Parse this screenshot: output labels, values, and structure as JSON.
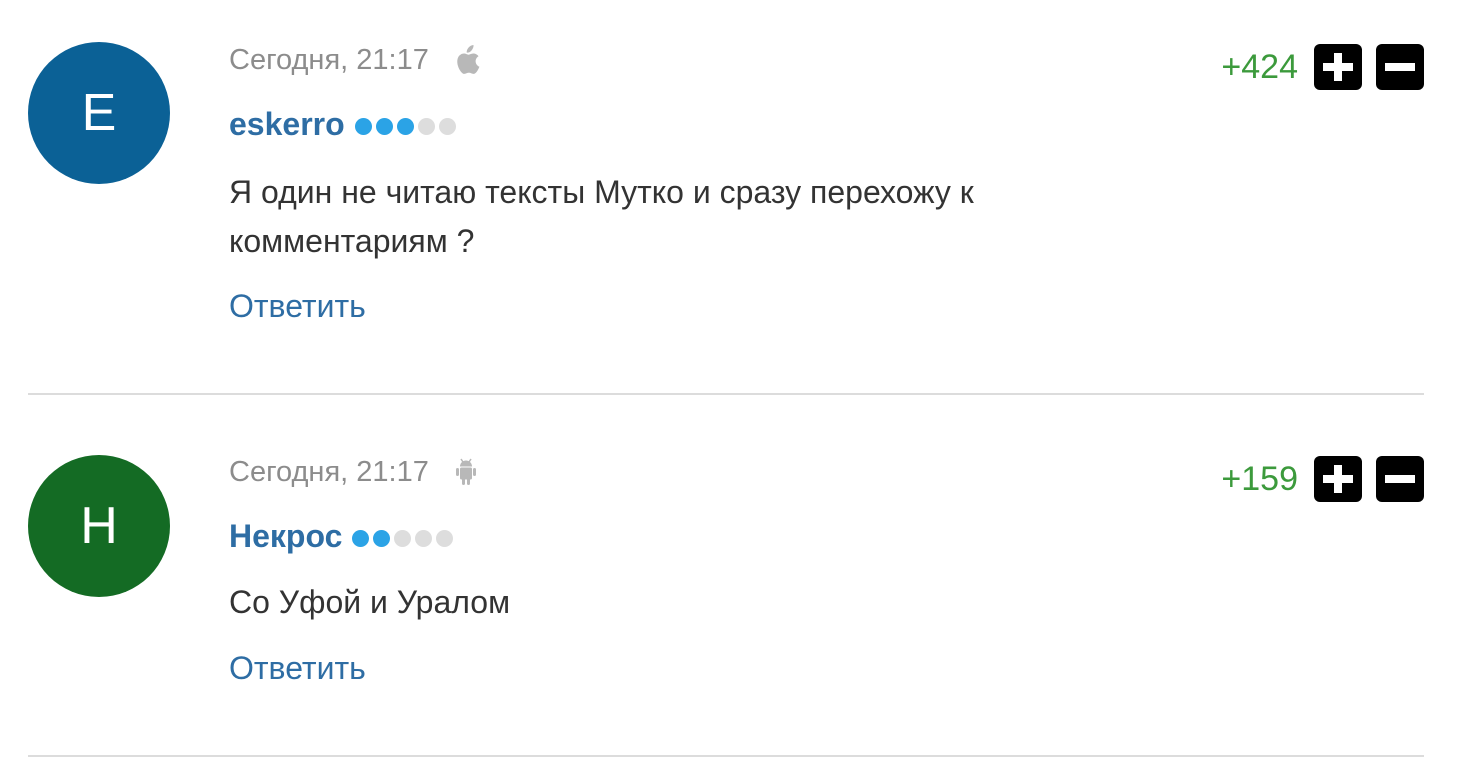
{
  "comments": [
    {
      "avatar_letter": "E",
      "avatar_color": "#0b6196",
      "time": "Сегодня, 21:17",
      "device": "apple-icon",
      "author": "eskerro",
      "rank_filled": 3,
      "rank_total": 5,
      "text": "Я один не читаю тексты Мутко и сразу перехожу к комментариям ?",
      "reply_label": "Ответить",
      "score": "+424"
    },
    {
      "avatar_letter": "Н",
      "avatar_color": "#146b24",
      "time": "Сегодня, 21:17",
      "device": "android-icon",
      "author": "Некрос",
      "rank_filled": 2,
      "rank_total": 5,
      "text": "Со Уфой и Уралом",
      "reply_label": "Ответить",
      "score": "+159"
    }
  ],
  "colors": {
    "author": "#2e6da4",
    "score_positive": "#3c9a3c",
    "rank_on": "#2ba3e6",
    "rank_off": "#dddddd"
  }
}
